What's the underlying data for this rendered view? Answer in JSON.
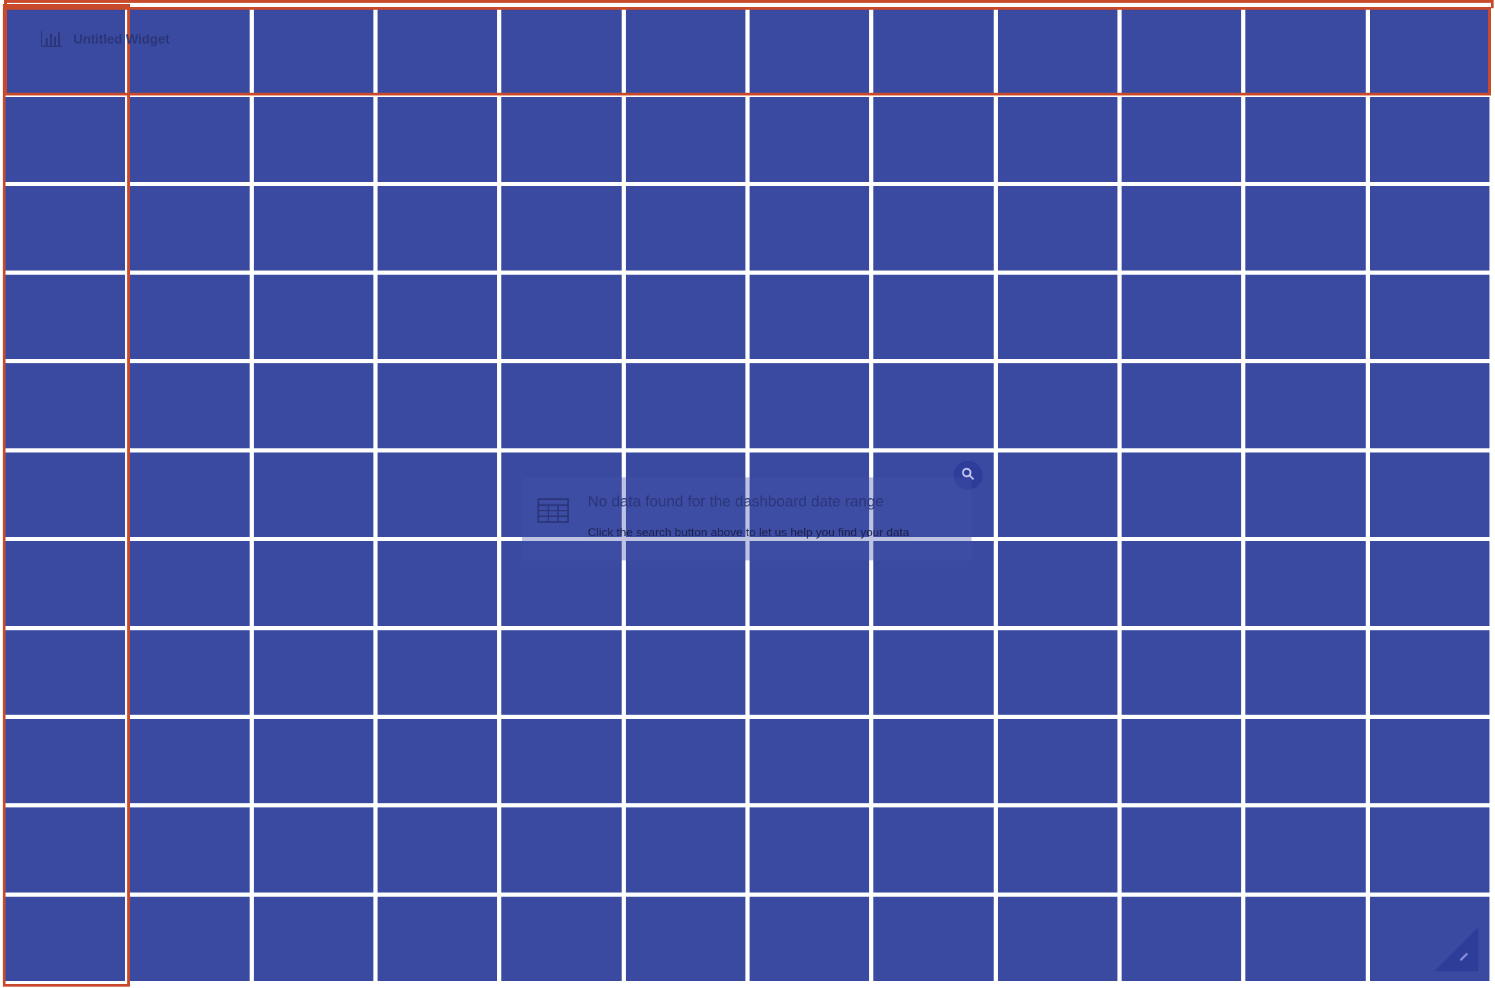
{
  "widget": {
    "title": "Untitled Widget",
    "icon": "bar-chart-icon"
  },
  "empty_state": {
    "icon": "table-icon",
    "title": "No data found for the dashboard date range",
    "subtitle": "Click the search button above to let us help you find your data"
  },
  "search": {
    "icon": "search-icon"
  },
  "grid": {
    "columns": 12,
    "rows": 11
  },
  "colors": {
    "cell": "#3a4aa0",
    "highlight": "#c84a2a",
    "accent": "#2e3c9a"
  }
}
